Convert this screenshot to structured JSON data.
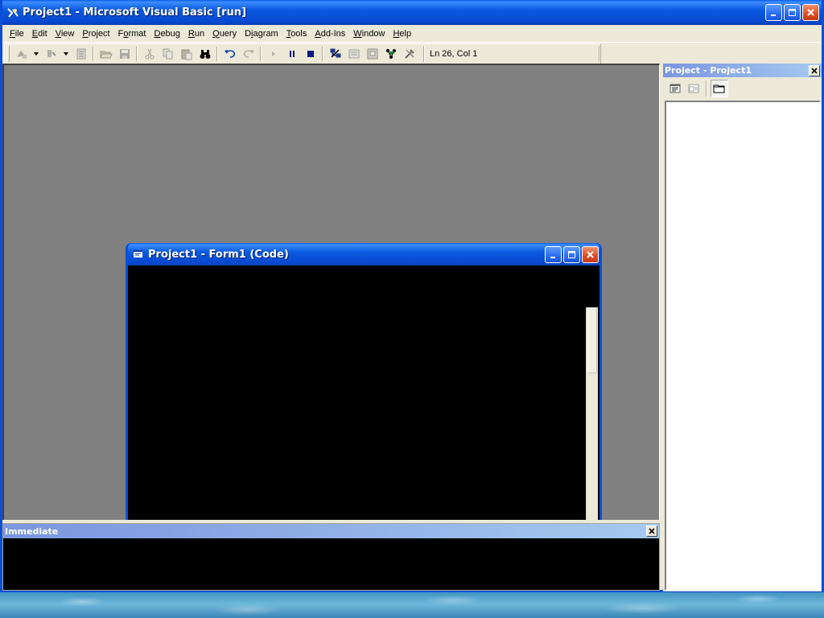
{
  "main_window": {
    "title": "Project1 - Microsoft Visual Basic [run]"
  },
  "menu": {
    "items": [
      {
        "key": "F",
        "rest": "ile"
      },
      {
        "key": "E",
        "rest": "dit"
      },
      {
        "key": "V",
        "rest": "iew"
      },
      {
        "key": "P",
        "rest": "roject"
      },
      {
        "key": "",
        "rest": "Format",
        "pre": "F",
        "mid": "o",
        "post": "rmat"
      },
      {
        "key": "D",
        "rest": "ebug"
      },
      {
        "key": "R",
        "rest": "un"
      },
      {
        "key": "Q",
        "rest": "uery"
      },
      {
        "key": "",
        "pre": "D",
        "mid": "i",
        "post": "agram"
      },
      {
        "key": "T",
        "rest": "ools"
      },
      {
        "key": "A",
        "rest": "dd-Ins"
      },
      {
        "key": "W",
        "rest": "indow"
      },
      {
        "key": "H",
        "rest": "elp"
      }
    ]
  },
  "toolbar": {
    "cursor_position": "Ln 26, Col 1"
  },
  "code_window": {
    "title": "Project1 - Form1 (Code)"
  },
  "immediate_window": {
    "title": "Immediate"
  },
  "project_explorer": {
    "title": "Project - Project1"
  },
  "colors": {
    "xp_title_blue": "#0a5ae0",
    "toolwindow_title": "#7a96df",
    "mdi_background": "#808080",
    "face": "#ece9d8",
    "close_red": "#de5129"
  }
}
